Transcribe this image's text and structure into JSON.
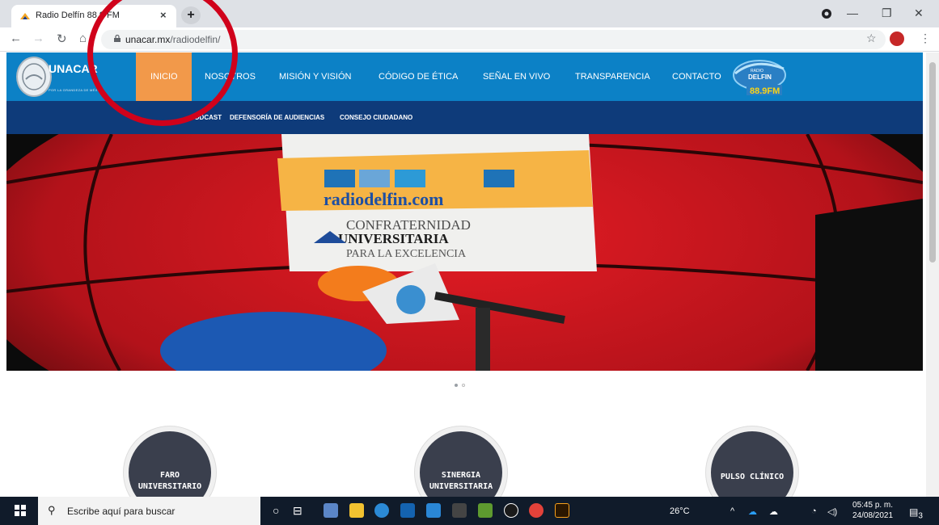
{
  "browser": {
    "tab_title": "Radio Delfín 88.9 FM",
    "new_tab_label": "+",
    "tab_close": "×",
    "url_host": "unacar.mx",
    "url_path": "/radiodelfin/",
    "nav_icons": [
      "back-icon",
      "forward-icon",
      "reload-icon",
      "home-icon"
    ],
    "window_controls": [
      "—",
      "❐",
      "✕"
    ]
  },
  "site": {
    "logo_text": "UNACAR",
    "logo_sub": "POR LA GRANDEZA DE MÉXICO",
    "nav": [
      "INICIO",
      "NOSOTROS",
      "MISIÓN Y VISIÓN",
      "CÓDIGO DE ÉTICA",
      "SEÑAL EN VIVO",
      "TRANSPARENCIA",
      "CONTACTO"
    ],
    "subnav": [
      "PODCAST",
      "DEFENSORÍA DE AUDIENCIAS",
      "CONSEJO CIUDADANO"
    ],
    "radio_logo": {
      "line1": "RADIO",
      "line2": "DELFIN",
      "freq": "88.9FM"
    }
  },
  "hero": {
    "banner_site": "radiodelfin.com",
    "banner_line1": "CONFRATERNIDAD",
    "banner_line2": "UNIVERSITARIA",
    "banner_line3": "PARA LA EXCELENCIA",
    "slides_total": 2,
    "slide_active": 1
  },
  "programs": [
    {
      "label": "FARO UNIVERSITARIO"
    },
    {
      "label": "SINERGIA UNIVERSITARIA"
    },
    {
      "label": "PULSO CLÍNICO"
    }
  ],
  "taskbar": {
    "search_placeholder": "Escribe aquí para buscar",
    "weather": "26°C",
    "time": "05:45 p. m.",
    "date": "24/08/2021",
    "notification_count": "3",
    "colors": {
      "accent": "#0c81c6",
      "nav_active": "#f2994a",
      "subnav": "#0e3b7a",
      "annotation": "#d0021b"
    }
  }
}
